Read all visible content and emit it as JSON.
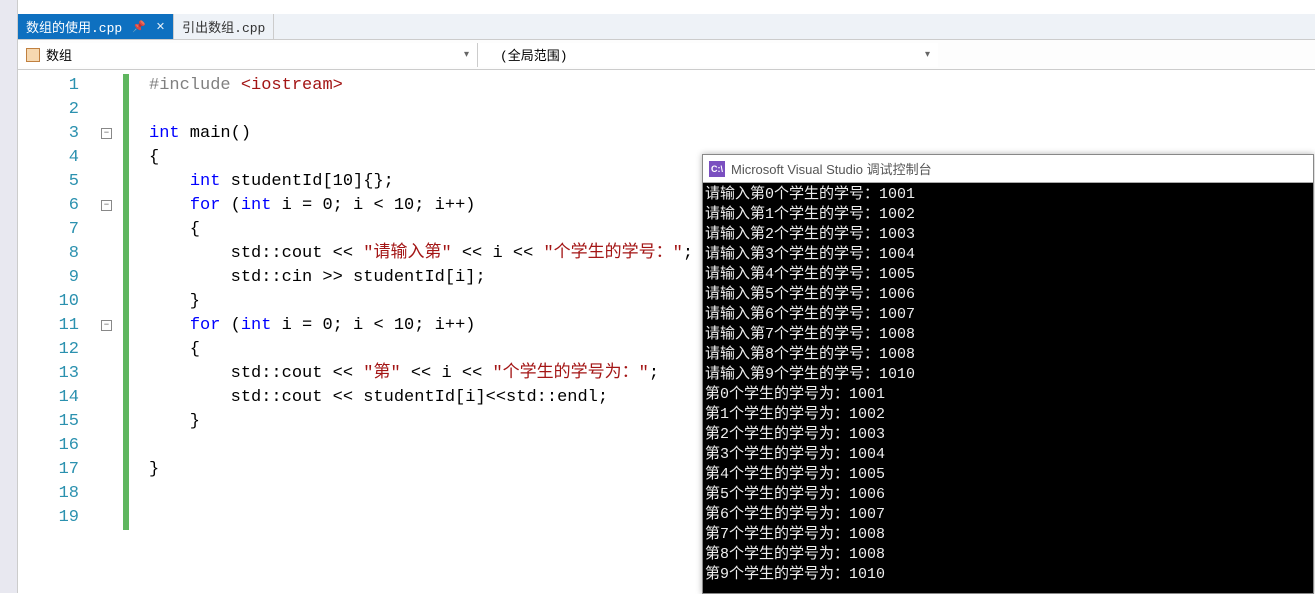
{
  "tabs": [
    {
      "label": "数组的使用.cpp",
      "active": true,
      "pinned": true
    },
    {
      "label": "引出数组.cpp",
      "active": false,
      "pinned": false
    }
  ],
  "dropdowns": {
    "left": "数组",
    "right": "(全局范围)"
  },
  "code": {
    "lines": [
      {
        "n": 1,
        "segs": [
          [
            "pp",
            "#include "
          ],
          [
            "inc",
            "<iostream>"
          ]
        ]
      },
      {
        "n": 2,
        "segs": []
      },
      {
        "n": 3,
        "segs": [
          [
            "kw",
            "int"
          ],
          [
            "txt",
            " main()"
          ]
        ],
        "fold": true
      },
      {
        "n": 4,
        "segs": [
          [
            "txt",
            "{"
          ]
        ]
      },
      {
        "n": 5,
        "segs": [
          [
            "txt",
            "    "
          ],
          [
            "kw",
            "int"
          ],
          [
            "txt",
            " studentId[10]{};"
          ]
        ]
      },
      {
        "n": 6,
        "segs": [
          [
            "txt",
            "    "
          ],
          [
            "kw",
            "for"
          ],
          [
            "txt",
            " ("
          ],
          [
            "kw",
            "int"
          ],
          [
            "txt",
            " i = 0; i < 10; i++)"
          ]
        ],
        "fold": true
      },
      {
        "n": 7,
        "segs": [
          [
            "txt",
            "    {"
          ]
        ]
      },
      {
        "n": 8,
        "segs": [
          [
            "txt",
            "        std::cout << "
          ],
          [
            "str",
            "\"请输入第\""
          ],
          [
            "txt",
            " << i << "
          ],
          [
            "str",
            "\"个学生的学号：\""
          ],
          [
            "txt",
            ";"
          ]
        ]
      },
      {
        "n": 9,
        "segs": [
          [
            "txt",
            "        std::cin >> studentId[i];"
          ]
        ]
      },
      {
        "n": 10,
        "segs": [
          [
            "txt",
            "    }"
          ]
        ]
      },
      {
        "n": 11,
        "segs": [
          [
            "txt",
            "    "
          ],
          [
            "kw",
            "for"
          ],
          [
            "txt",
            " ("
          ],
          [
            "kw",
            "int"
          ],
          [
            "txt",
            " i = 0; i < 10; i++)"
          ]
        ],
        "fold": true
      },
      {
        "n": 12,
        "segs": [
          [
            "txt",
            "    {"
          ]
        ]
      },
      {
        "n": 13,
        "segs": [
          [
            "txt",
            "        std::cout << "
          ],
          [
            "str",
            "\"第\""
          ],
          [
            "txt",
            " << i << "
          ],
          [
            "str",
            "\"个学生的学号为：\""
          ],
          [
            "txt",
            ";"
          ]
        ]
      },
      {
        "n": 14,
        "segs": [
          [
            "txt",
            "        std::cout << studentId[i]<<std::endl;"
          ]
        ]
      },
      {
        "n": 15,
        "segs": [
          [
            "txt",
            "    }"
          ]
        ]
      },
      {
        "n": 16,
        "segs": []
      },
      {
        "n": 17,
        "segs": [
          [
            "txt",
            "}"
          ]
        ]
      },
      {
        "n": 18,
        "segs": []
      },
      {
        "n": 19,
        "segs": []
      }
    ]
  },
  "console": {
    "title": "Microsoft Visual Studio 调试控制台",
    "lines": [
      "请输入第0个学生的学号：1001",
      "请输入第1个学生的学号：1002",
      "请输入第2个学生的学号：1003",
      "请输入第3个学生的学号：1004",
      "请输入第4个学生的学号：1005",
      "请输入第5个学生的学号：1006",
      "请输入第6个学生的学号：1007",
      "请输入第7个学生的学号：1008",
      "请输入第8个学生的学号：1008",
      "请输入第9个学生的学号：1010",
      "第0个学生的学号为：1001",
      "第1个学生的学号为：1002",
      "第2个学生的学号为：1003",
      "第3个学生的学号为：1004",
      "第4个学生的学号为：1005",
      "第5个学生的学号为：1006",
      "第6个学生的学号为：1007",
      "第7个学生的学号为：1008",
      "第8个学生的学号为：1008",
      "第9个学生的学号为：1010"
    ]
  }
}
